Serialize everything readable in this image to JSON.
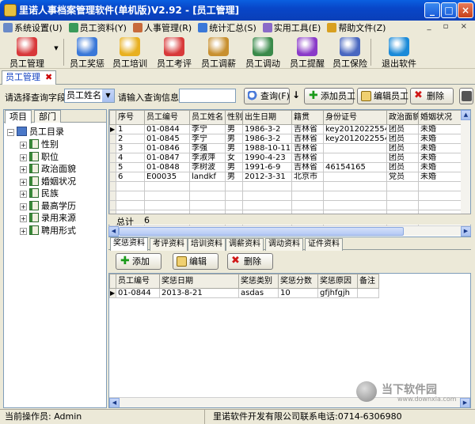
{
  "window": {
    "title": "里诺人事档案管理软件(单机版)V2.92 - [员工管理]"
  },
  "menu": [
    {
      "label": "系统设置(U)",
      "icon": "settings-icon"
    },
    {
      "label": "员工资料(Y)",
      "icon": "profile-icon"
    },
    {
      "label": "人事管理(R)",
      "icon": "hr-icon"
    },
    {
      "label": "统计汇总(S)",
      "icon": "stats-icon"
    },
    {
      "label": "实用工具(E)",
      "icon": "tools-icon"
    },
    {
      "label": "帮助文件(Z)",
      "icon": "help-icon"
    }
  ],
  "toolbar": [
    {
      "label": "员工管理",
      "icon": "employee-icon",
      "color": "#d8383a"
    },
    {
      "label": "员工奖惩",
      "icon": "reward-icon",
      "color": "#3a78d8"
    },
    {
      "label": "员工培训",
      "icon": "training-icon",
      "color": "#e8b020"
    },
    {
      "label": "员工考评",
      "icon": "evaluate-icon",
      "color": "#d83a3a"
    },
    {
      "label": "员工调薪",
      "icon": "salary-icon",
      "color": "#c89030"
    },
    {
      "label": "员工调动",
      "icon": "transfer-icon",
      "color": "#3a8a4a"
    },
    {
      "label": "员工提醒",
      "icon": "reminder-icon",
      "color": "#8a3ac8"
    },
    {
      "label": "员工保险",
      "icon": "insurance-icon",
      "color": "#4a68c0"
    },
    {
      "label": "退出软件",
      "icon": "exit-icon",
      "color": "#1a8ad8"
    }
  ],
  "doc_tab": {
    "label": "员工管理"
  },
  "query": {
    "field_label": "请选择查询字段",
    "field_value": "员工姓名",
    "info_label": "请输入查询信息",
    "info_value": "",
    "query_btn": "查询(F)",
    "add_btn": "添加员工",
    "edit_btn": "编辑员工",
    "delete_btn": "删除"
  },
  "left_tabs": [
    "项目",
    "部门"
  ],
  "tree": {
    "root": "员工目录",
    "children": [
      "性别",
      "职位",
      "政治面貌",
      "婚姻状况",
      "民族",
      "最高学历",
      "录用来源",
      "聘用形式"
    ]
  },
  "grid": {
    "columns": [
      "序号",
      "员工编号",
      "员工姓名",
      "性别",
      "出生日期",
      "籍贯",
      "身份证号",
      "政治面貌",
      "婚姻状况"
    ],
    "rows": [
      [
        "1",
        "01-0844",
        "李宁",
        "男",
        "1986-3-2",
        "吉林省",
        "key2012022554",
        "团员",
        "未婚"
      ],
      [
        "2",
        "01-0845",
        "李宁",
        "男",
        "1986-3-2",
        "吉林省",
        "key2012022554",
        "团员",
        "未婚"
      ],
      [
        "3",
        "01-0846",
        "李强",
        "男",
        "1988-10-11",
        "吉林省",
        "",
        "团员",
        "未婚"
      ],
      [
        "4",
        "01-0847",
        "李淑萍",
        "女",
        "1990-4-23",
        "吉林省",
        "",
        "团员",
        "未婚"
      ],
      [
        "5",
        "01-0848",
        "李树波",
        "男",
        "1991-6-9",
        "吉林省",
        "46154165",
        "团员",
        "未婚"
      ],
      [
        "6",
        "E00035",
        "landkf",
        "男",
        "2012-3-31",
        "北京市",
        "",
        "党员",
        "未婚"
      ]
    ],
    "total_label": "总计",
    "total_value": "6"
  },
  "sub_tabs": [
    "奖惩资料",
    "考评资料",
    "培训资料",
    "调薪资料",
    "调动资料",
    "证件资料"
  ],
  "sub_buttons": {
    "add": "添加",
    "edit": "编辑",
    "delete": "删除"
  },
  "sub_grid": {
    "columns": [
      "员工编号",
      "奖惩日期",
      "奖惩类别",
      "奖惩分数",
      "奖惩原因",
      "备注"
    ],
    "rows": [
      [
        "01-0844",
        "2013-8-21",
        "asdas",
        "10",
        "gfjhfgjh",
        ""
      ]
    ]
  },
  "status": {
    "operator": "当前操作员: Admin",
    "company": "里诺软件开发有限公司联系电话:0714-6306980"
  },
  "watermark": {
    "text": "当下软件园",
    "url": "www.downxia.com"
  }
}
